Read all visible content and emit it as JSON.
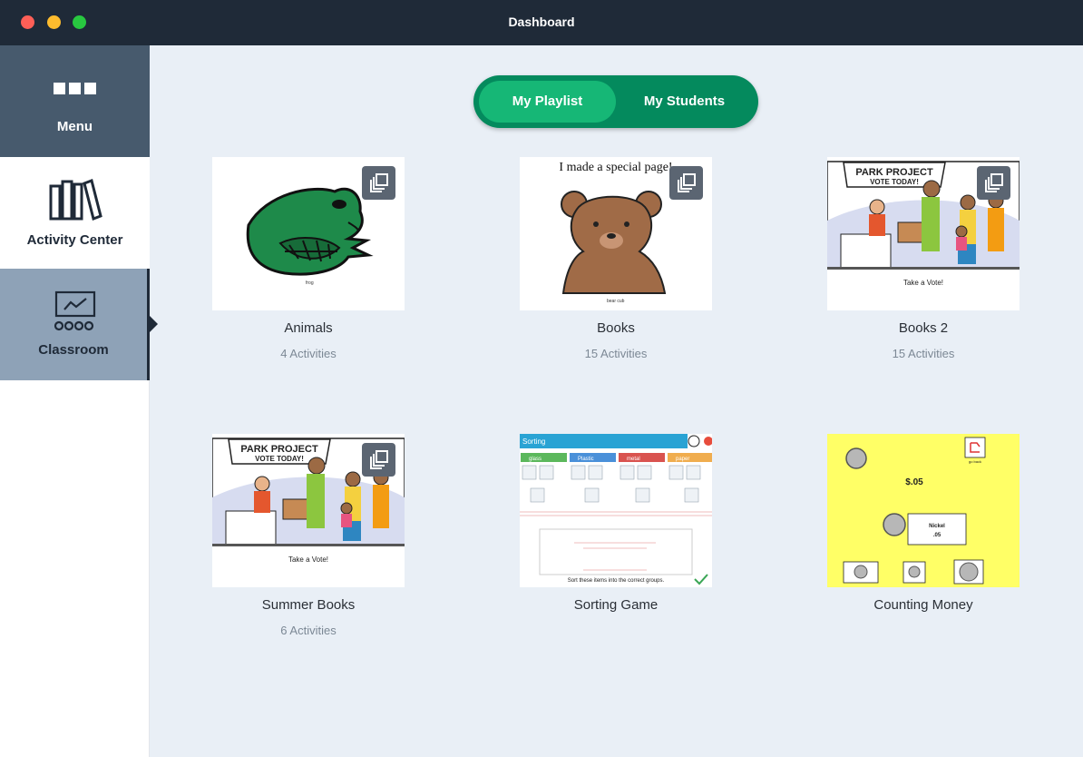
{
  "window": {
    "title": "Dashboard"
  },
  "sidebar": {
    "menu_label": "Menu",
    "activity_center_label": "Activity Center",
    "classroom_label": "Classroom"
  },
  "toggle": {
    "playlist_label": "My Playlist",
    "students_label": "My Students"
  },
  "colors": {
    "accent": "#16b776",
    "accent_dark": "#048a5d",
    "titlebar": "#1f2a38",
    "sidebar_menu": "#475a6d",
    "sidebar_selected": "#8ea2b7"
  },
  "cards": [
    {
      "title": "Animals",
      "subtitle": "4 Activities",
      "thumb_text": "frog"
    },
    {
      "title": "Books",
      "subtitle": "15 Activities",
      "thumb_text": "I made a special page!",
      "thumb_caption": "bear cub"
    },
    {
      "title": "Books 2",
      "subtitle": "15 Activities",
      "sign_line1": "PARK PROJECT",
      "sign_line2": "VOTE TODAY!",
      "caption": "Take a Vote!"
    },
    {
      "title": "Summer Books",
      "subtitle": "6 Activities",
      "sign_line1": "PARK PROJECT",
      "sign_line2": "VOTE TODAY!",
      "caption": "Take a Vote!"
    },
    {
      "title": "Sorting Game",
      "thumb_header": "Sorting",
      "categories": [
        "glass",
        "Plastic",
        "metal",
        "paper"
      ],
      "footer": "Sort these items into the correct groups."
    },
    {
      "title": "Counting Money",
      "amount": "$.05",
      "coin_label": "Nickel",
      "coin_value": ".05",
      "corner_label": "go back"
    }
  ]
}
